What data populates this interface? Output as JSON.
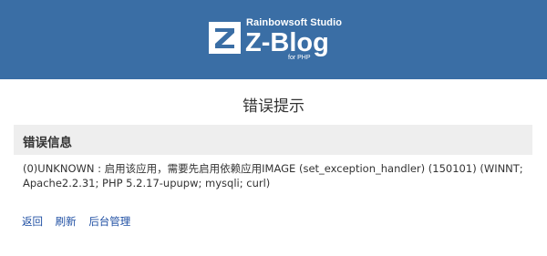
{
  "header": {
    "studio": "Rainbowsoft Studio",
    "name": "Z-Blog",
    "sub": "for PHP",
    "bg_color": "#3a6ea5",
    "logo_icon": "z-letter-icon"
  },
  "page_title": "错误提示",
  "panel": {
    "title": "错误信息",
    "message": "(0)UNKNOWN : 启用该应用，需要先启用依赖应用IMAGE (set_exception_handler) (150101) (WINNT; Apache2.2.31; PHP 5.2.17-upupw; mysqli; curl)"
  },
  "links": {
    "back": "返回",
    "refresh": "刷新",
    "admin": "后台管理",
    "color": "#1f4fa3"
  }
}
